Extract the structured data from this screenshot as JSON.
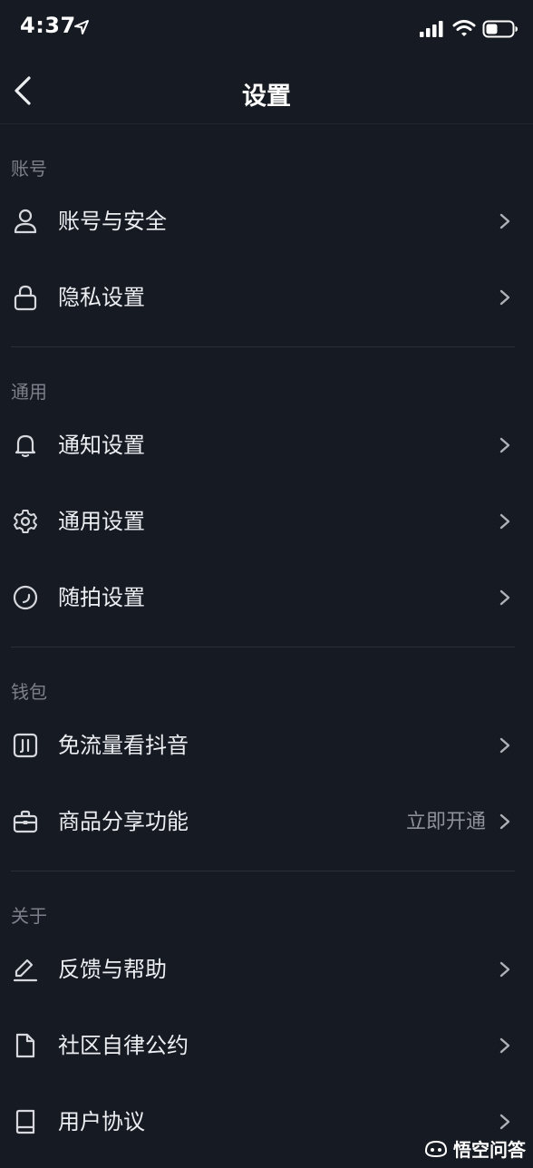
{
  "status_bar": {
    "time": "4:37",
    "icons": [
      "location-arrow-icon",
      "cellular-signal-icon",
      "wifi-icon",
      "battery-icon"
    ]
  },
  "nav": {
    "title": "设置",
    "back_icon": "chevron-left-icon"
  },
  "sections": [
    {
      "header": "账号",
      "items": [
        {
          "label": "账号与安全",
          "icon": "user-icon"
        },
        {
          "label": "隐私设置",
          "icon": "lock-icon"
        }
      ]
    },
    {
      "header": "通用",
      "items": [
        {
          "label": "通知设置",
          "icon": "bell-icon"
        },
        {
          "label": "通用设置",
          "icon": "gear-icon"
        },
        {
          "label": "随拍设置",
          "icon": "circle-capture-icon"
        }
      ]
    },
    {
      "header": "钱包",
      "items": [
        {
          "label": "免流量看抖音",
          "icon": "data-card-icon"
        },
        {
          "label": "商品分享功能",
          "icon": "briefcase-icon",
          "value": "立即开通"
        }
      ]
    },
    {
      "header": "关于",
      "items": [
        {
          "label": "反馈与帮助",
          "icon": "pencil-icon"
        },
        {
          "label": "社区自律公约",
          "icon": "document-icon"
        },
        {
          "label": "用户协议",
          "icon": "book-icon"
        }
      ]
    }
  ],
  "watermark": {
    "text": "悟空问答",
    "icon": "wukong-logo-icon"
  },
  "colors": {
    "background": "#161a22",
    "text_primary": "#eceef2",
    "text_secondary": "#7d808a",
    "divider": "#2a2e37"
  }
}
